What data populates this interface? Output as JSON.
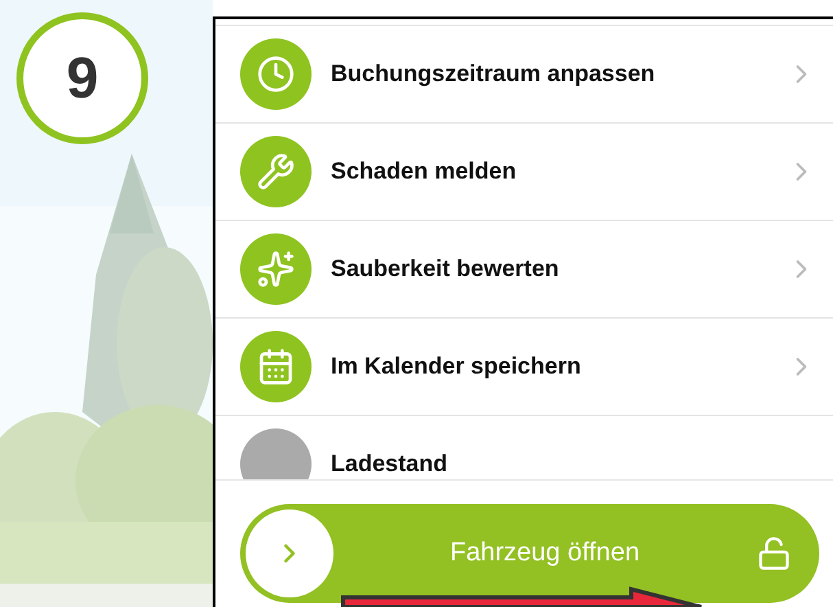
{
  "step": {
    "number": "9"
  },
  "menu": [
    {
      "kind": "clock",
      "label": "Buchungszeitraum anpassen",
      "active": true
    },
    {
      "kind": "wrench",
      "label": "Schaden melden",
      "active": true
    },
    {
      "kind": "sparkles",
      "label": "Sauberkeit bewerten",
      "active": true
    },
    {
      "kind": "calendar",
      "label": "Im Kalender speichern",
      "active": true
    },
    {
      "kind": "plain",
      "label": "Ladestand",
      "active": false
    }
  ],
  "slider": {
    "label": "Fahrzeug öffnen",
    "level": 0
  }
}
